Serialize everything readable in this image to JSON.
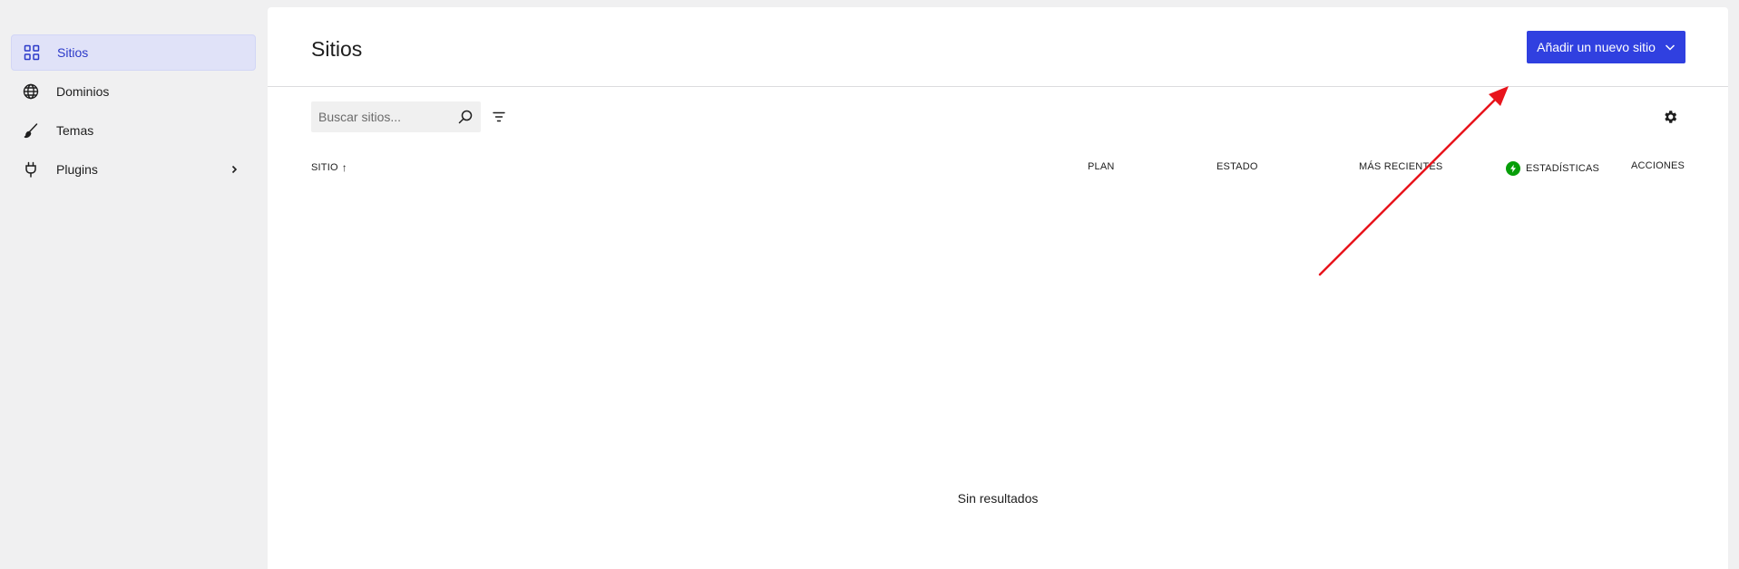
{
  "sidebar": {
    "items": [
      {
        "label": "Sitios",
        "icon": "grid-icon",
        "active": true
      },
      {
        "label": "Dominios",
        "icon": "globe-icon",
        "active": false
      },
      {
        "label": "Temas",
        "icon": "brush-icon",
        "active": false
      },
      {
        "label": "Plugins",
        "icon": "plug-icon",
        "active": false,
        "has_submenu": true
      }
    ]
  },
  "header": {
    "title": "Sitios",
    "add_button_label": "Añadir un nuevo sitio"
  },
  "toolbar": {
    "search_placeholder": "Buscar sitios...",
    "search_value": ""
  },
  "table": {
    "columns": {
      "site": "SITIO",
      "site_sort": "↑",
      "plan": "PLAN",
      "status": "ESTADO",
      "recent": "MÁS RECIENTES",
      "stats": "ESTADÍSTICAS",
      "actions": "ACCIONES"
    },
    "empty_message": "Sin resultados"
  },
  "colors": {
    "accent": "#3040e0",
    "sidebar_active_bg": "#e0e2f8",
    "sidebar_active_text": "#2b39c9",
    "stats_badge": "#069e08",
    "annotation_arrow": "#e8141c"
  }
}
